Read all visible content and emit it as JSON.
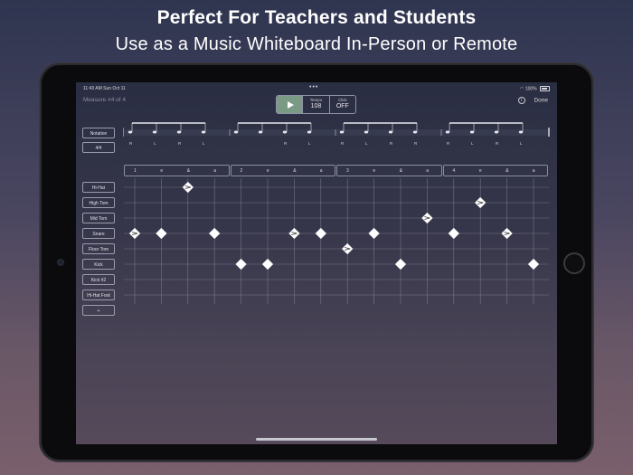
{
  "headline": "Perfect For Teachers and Students",
  "subline": "Use as a Music Whiteboard In-Person or Remote",
  "status": {
    "time": "11:43 AM  Sun Oct 11",
    "dots": "•••",
    "battery": "100%"
  },
  "header": {
    "measure": "Measure #4 of 4",
    "done": "Done",
    "info_glyph": "i"
  },
  "transport": {
    "tempo_label": "Tempo",
    "tempo_value": "108",
    "click_label": "Click",
    "click_value": "OFF"
  },
  "left_panel": {
    "notation_label": "Notation",
    "time_signature": "4/4",
    "add_label": "+"
  },
  "instruments": [
    "Hi-Hat",
    "High Tom",
    "Mid Tom",
    "Snare",
    "Floor Tom",
    "Kick",
    "Kick #2",
    "Hi-Hat Foot"
  ],
  "sticking": [
    "R",
    "L",
    "R",
    "L",
    "",
    "",
    "R",
    "L",
    "R",
    "L",
    "R",
    "R",
    "R",
    "L",
    "R",
    "L"
  ],
  "beat_labels": [
    [
      "1",
      "e",
      "&",
      "a"
    ],
    [
      "2",
      "e",
      "&",
      "a"
    ],
    [
      "3",
      "e",
      "&",
      "a"
    ],
    [
      "4",
      "e",
      "&",
      "a"
    ]
  ],
  "pattern": [
    {
      "step": 0,
      "row": 3,
      "accent": true
    },
    {
      "step": 1,
      "row": 3,
      "accent": false
    },
    {
      "step": 2,
      "row": 0,
      "accent": true
    },
    {
      "step": 3,
      "row": 3,
      "accent": false
    },
    {
      "step": 4,
      "row": 5,
      "accent": false
    },
    {
      "step": 5,
      "row": 5,
      "accent": false
    },
    {
      "step": 6,
      "row": 3,
      "accent": true
    },
    {
      "step": 7,
      "row": 3,
      "accent": false
    },
    {
      "step": 8,
      "row": 4,
      "accent": true
    },
    {
      "step": 9,
      "row": 3,
      "accent": false
    },
    {
      "step": 10,
      "row": 5,
      "accent": false
    },
    {
      "step": 11,
      "row": 2,
      "accent": true
    },
    {
      "step": 12,
      "row": 3,
      "accent": false
    },
    {
      "step": 13,
      "row": 1,
      "accent": true
    },
    {
      "step": 14,
      "row": 3,
      "accent": true
    },
    {
      "step": 15,
      "row": 5,
      "accent": false
    }
  ],
  "colors": {
    "play": "#7a9a85",
    "grid_line": "#8a8d9c",
    "note_fill": "#ffffff"
  }
}
